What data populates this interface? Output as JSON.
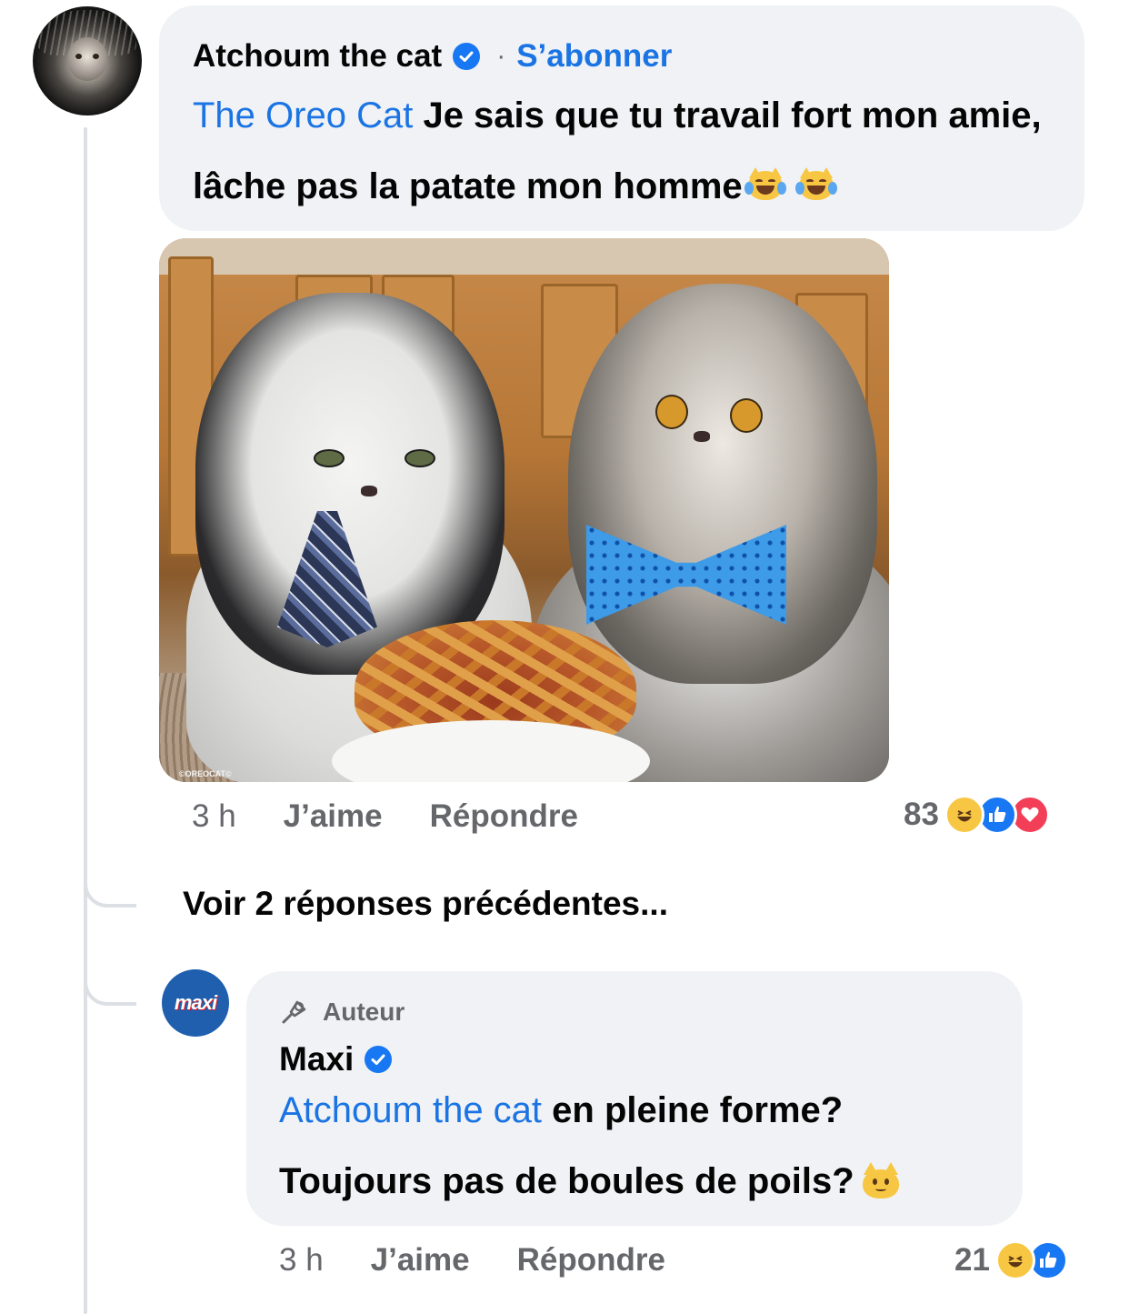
{
  "comment": {
    "author": "Atchoum the cat",
    "follow_label": "S’abonner",
    "separator": "·",
    "mention": "The Oreo Cat",
    "text": " Je sais que tu travail fort mon amie, lâche pas la patate mon homme",
    "image_watermark": "©OREOCAT©",
    "time": "3 h",
    "like_label": "J’aime",
    "reply_label": "Répondre",
    "reaction_count": "83",
    "reactions": [
      "haha-icon",
      "like-icon",
      "love-icon"
    ]
  },
  "view_previous_replies": "Voir 2 réponses précédentes...",
  "reply": {
    "avatar_text": "maxi",
    "badge": "Auteur",
    "author": "Maxi",
    "mention": "Atchoum the cat",
    "line1_text": " en pleine forme?",
    "line2_text": "Toujours pas de boules de poils?",
    "time": "3 h",
    "like_label": "J’aime",
    "reply_label": "Répondre",
    "reaction_count": "21",
    "reactions": [
      "haha-icon",
      "like-icon"
    ]
  },
  "colors": {
    "link_blue": "#1b74e4",
    "bubble_bg": "#f0f2f5",
    "meta_gray": "#65676b",
    "verified_blue": "#1877f2"
  }
}
